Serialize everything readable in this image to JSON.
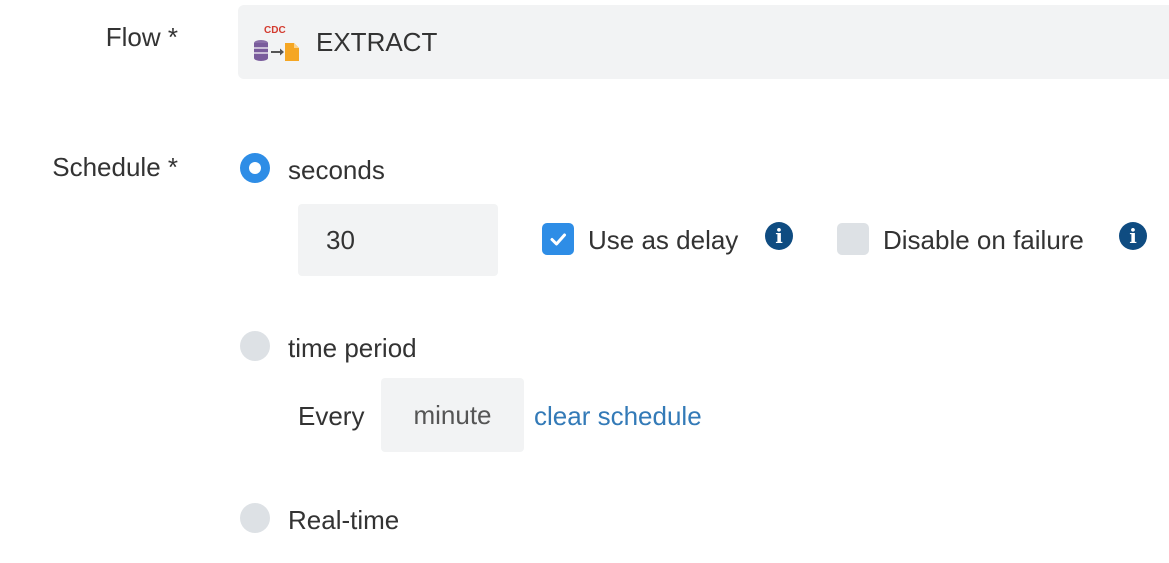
{
  "flow": {
    "label": "Flow *",
    "icon_badge": "CDC",
    "icon_name": "cdc-extract-icon",
    "value": "EXTRACT"
  },
  "schedule": {
    "label": "Schedule *",
    "options": {
      "seconds": {
        "label": "seconds",
        "selected": true
      },
      "time_period": {
        "label": "time period",
        "selected": false
      },
      "realtime": {
        "label": "Real-time",
        "selected": false
      }
    },
    "seconds_value": "30",
    "use_as_delay": {
      "label": "Use as delay",
      "checked": true
    },
    "disable_on_failure": {
      "label": "Disable on failure",
      "checked": false
    },
    "info_icon": "i",
    "every_label": "Every",
    "period_unit": "minute",
    "clear_link": "clear schedule"
  },
  "colors": {
    "accent": "#2e8de6",
    "info": "#0f4c81",
    "link": "#337ab7",
    "field_bg": "#f2f3f4",
    "control_off": "#dde1e5"
  }
}
